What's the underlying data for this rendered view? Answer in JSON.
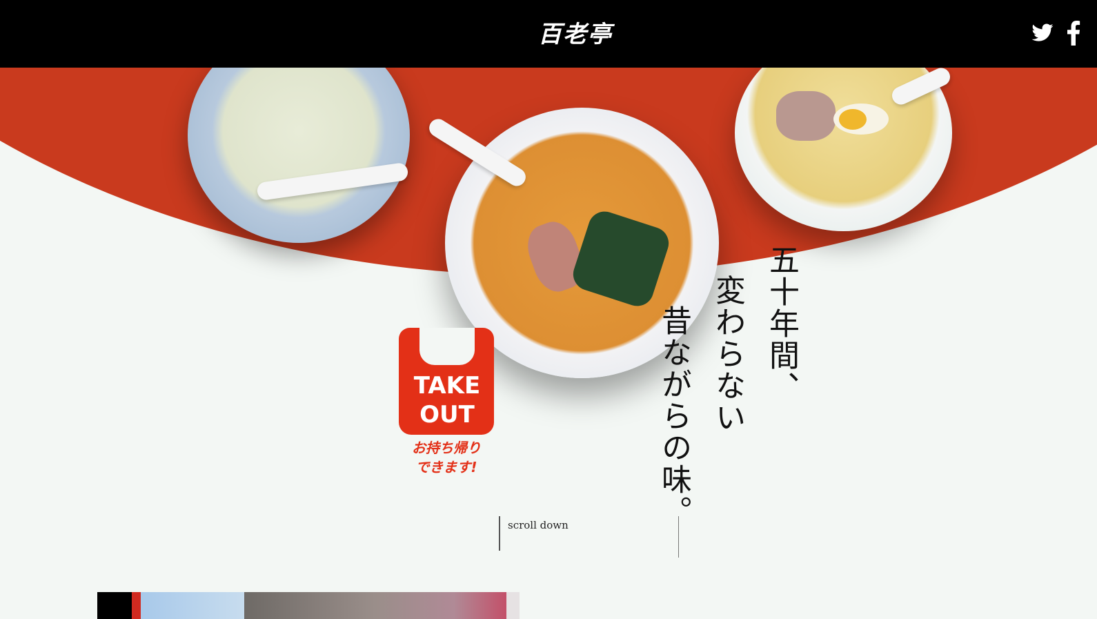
{
  "header": {
    "logo_text": "百老亭",
    "social": {
      "twitter_icon": "twitter-icon",
      "facebook_icon": "facebook-icon"
    }
  },
  "hero": {
    "tagline_lines": [
      "五十年間、",
      "変わらない",
      "昔ながらの味。"
    ]
  },
  "takeout": {
    "line1": "TAKE",
    "line2": "OUT",
    "sub1": "お持ち帰り",
    "sub2": "できます!"
  },
  "scroll_label": "scroll down",
  "colors": {
    "header_bg": "#000000",
    "accent_red": "#c93a1e",
    "page_bg": "#f3f7f4"
  }
}
